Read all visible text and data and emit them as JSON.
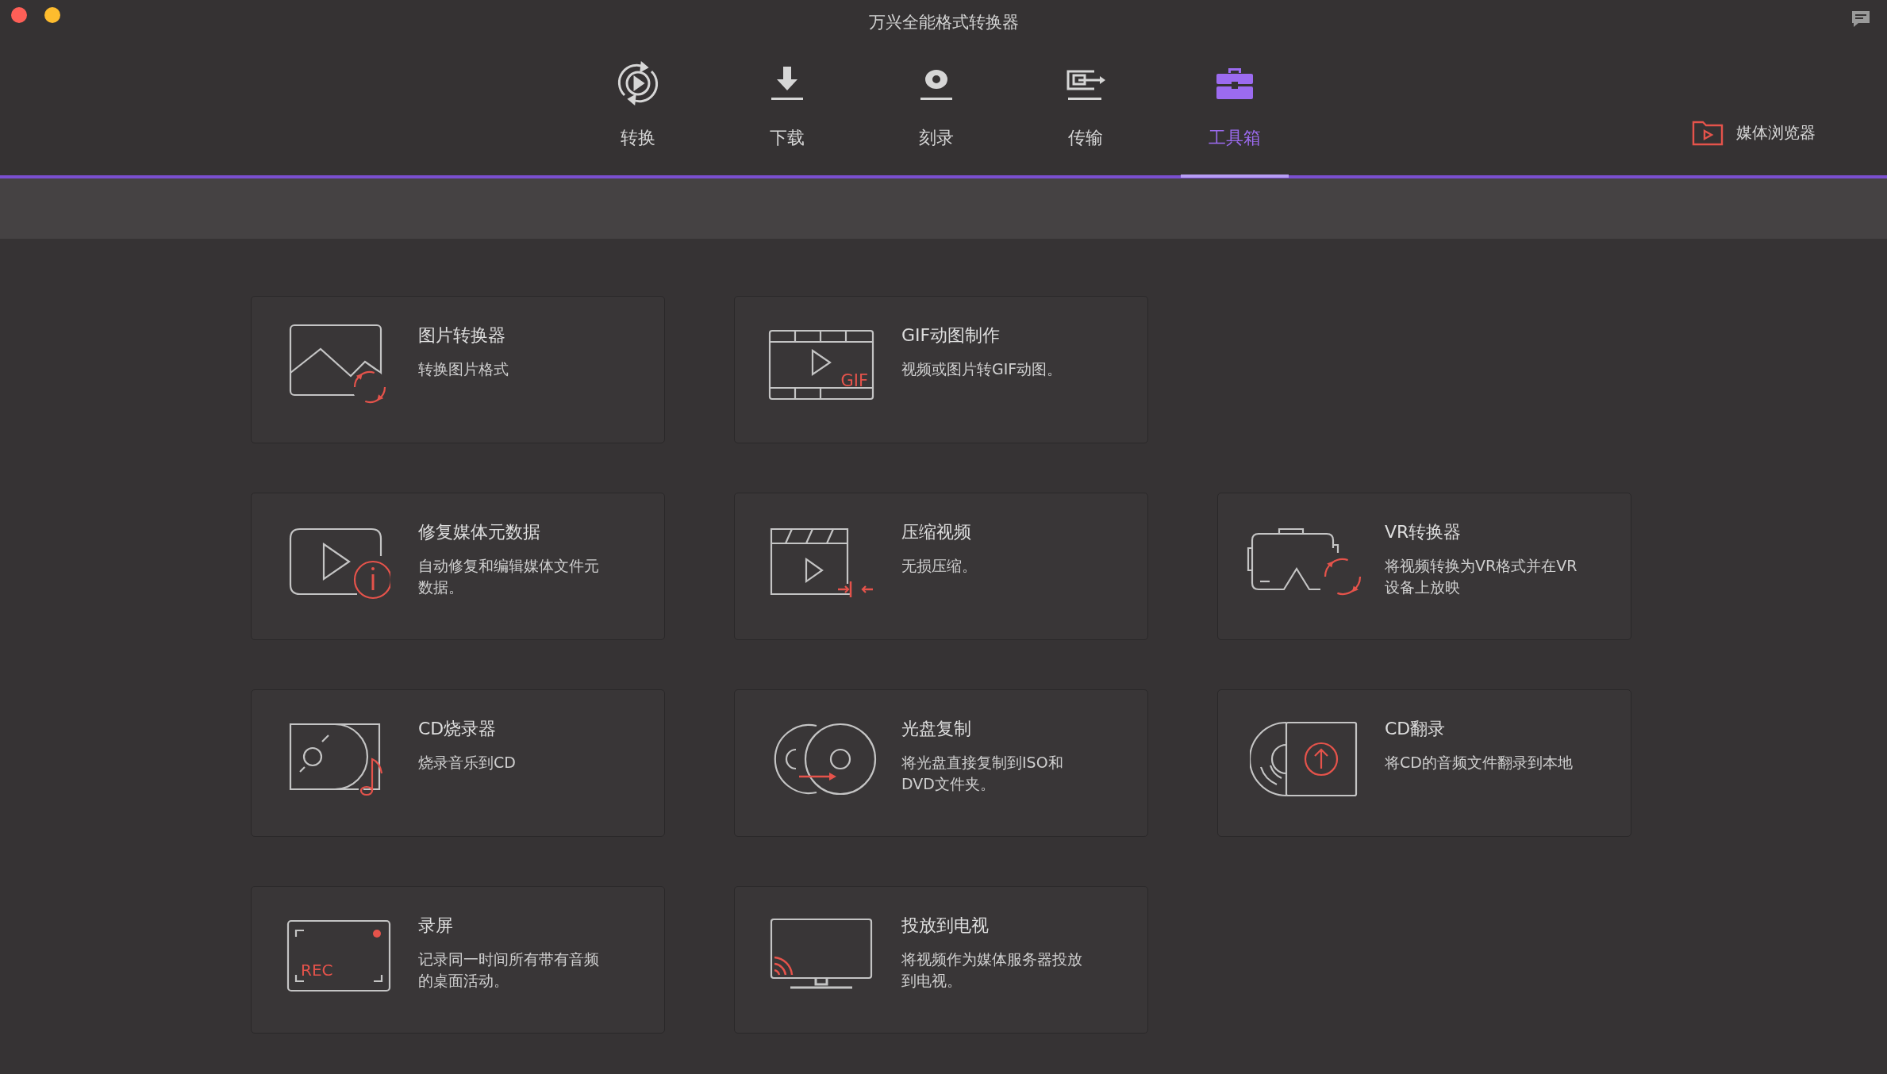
{
  "window": {
    "title": "万兴全能格式转换器"
  },
  "tabs": [
    {
      "kind": "convert",
      "label": "转换",
      "selected": false
    },
    {
      "kind": "download",
      "label": "下载",
      "selected": false
    },
    {
      "kind": "burn",
      "label": "刻录",
      "selected": false
    },
    {
      "kind": "transfer",
      "label": "传输",
      "selected": false
    },
    {
      "kind": "toolbox",
      "label": "工具箱",
      "selected": true
    }
  ],
  "media_browser": {
    "label": "媒体浏览器"
  },
  "tools": [
    [
      {
        "kind": "image",
        "title": "图片转换器",
        "description": "转换图片格式"
      },
      {
        "kind": "gif",
        "title": "GIF动图制作",
        "description": "视频或图片转GIF动图。",
        "icon_text": "GIF"
      }
    ],
    [
      {
        "kind": "metadata",
        "title": "修复媒体元数据",
        "description": "自动修复和编辑媒体文件元数据。"
      },
      {
        "kind": "compress",
        "title": "压缩视频",
        "description": "无损压缩。"
      },
      {
        "kind": "vr",
        "title": "VR转换器",
        "description": "将视频转换为VR格式并在VR设备上放映"
      }
    ],
    [
      {
        "kind": "cdburn",
        "title": "CD烧录器",
        "description": "烧录音乐到CD"
      },
      {
        "kind": "disccopy",
        "title": "光盘复制",
        "description": "将光盘直接复制到ISO和DVD文件夹。"
      },
      {
        "kind": "cdrip",
        "title": "CD翻录",
        "description": "将CD的音频文件翻录到本地"
      }
    ],
    [
      {
        "kind": "record",
        "title": "录屏",
        "description": "记录同一时间所有带有音频的桌面活动。",
        "icon_text": "REC"
      },
      {
        "kind": "cast",
        "title": "投放到电视",
        "description": "将视频作为媒体服务器投放到电视。"
      }
    ]
  ]
}
